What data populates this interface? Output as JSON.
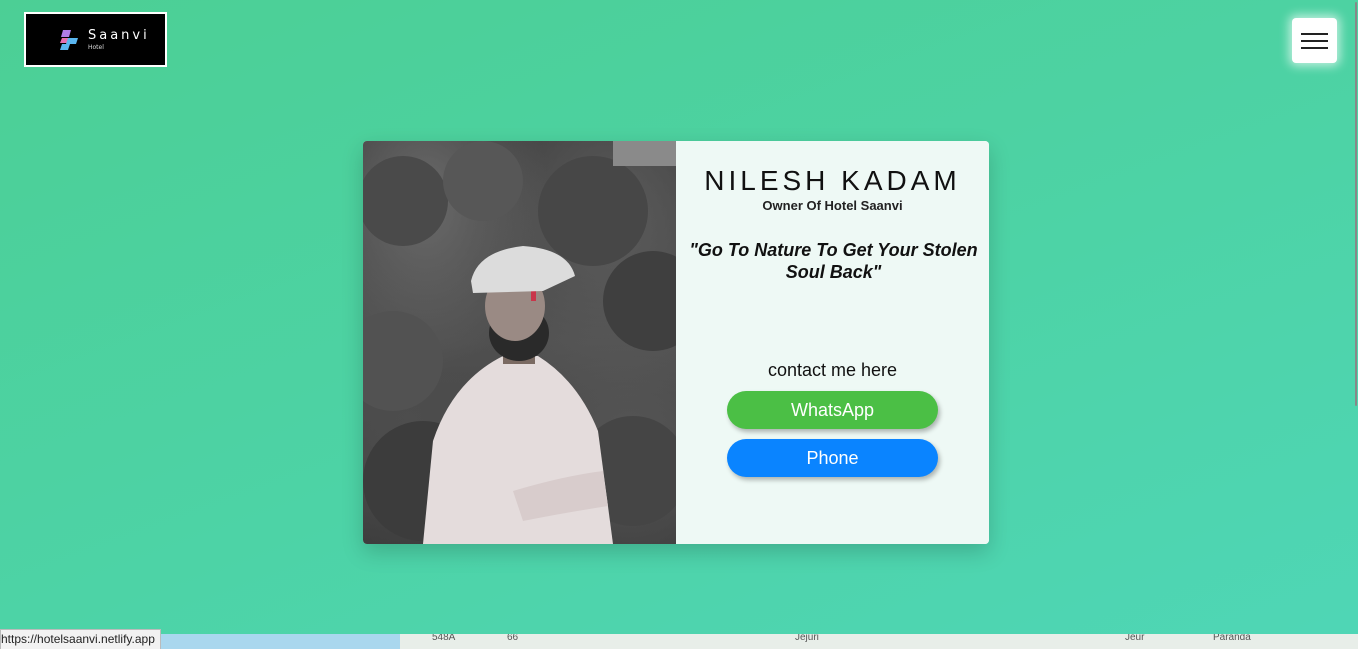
{
  "logo": {
    "name": "Saanvi",
    "sub": "Hotel"
  },
  "menu": {
    "icon": "hamburger-menu-icon"
  },
  "profile": {
    "name": "NILESH KADAM",
    "role": "Owner Of Hotel Saanvi",
    "quote": "\"Go To Nature To Get Your Stolen Soul Back\"",
    "contact_label": "contact me here",
    "buttons": {
      "whatsapp": "WhatsApp",
      "phone": "Phone"
    },
    "colors": {
      "whatsapp": "#4bbf45",
      "phone": "#0a84ff"
    }
  },
  "map": {
    "labels": [
      "548A",
      "66",
      "Jejuri",
      "Jeur",
      "Paranda"
    ]
  },
  "status_bar": {
    "url": "https://hotelsaanvi.netlify.app"
  },
  "theme": {
    "background": "#4dd3a6",
    "card_background": "#eef9f5"
  }
}
